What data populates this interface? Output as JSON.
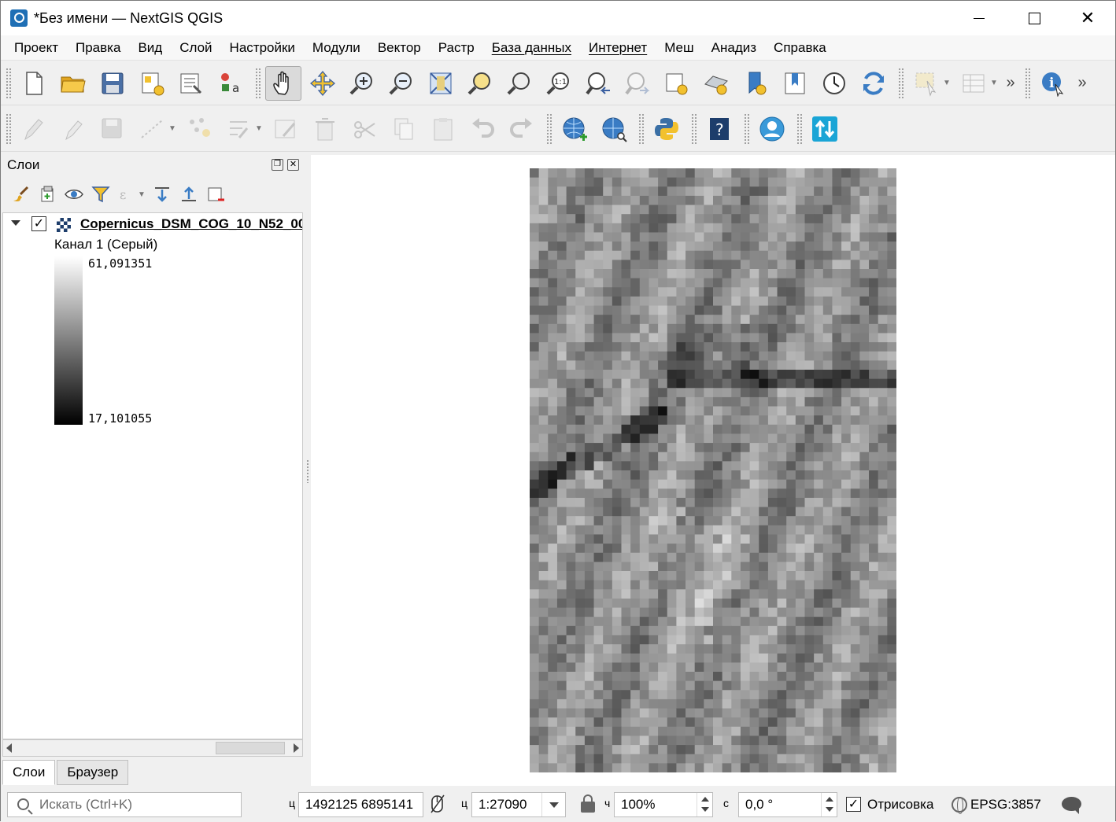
{
  "window": {
    "title": "*Без имени — NextGIS QGIS"
  },
  "menu": [
    "Проект",
    "Правка",
    "Вид",
    "Слой",
    "Настройки",
    "Модули",
    "Вектор",
    "Растр",
    "База данных",
    "Интернет",
    "Меш",
    "Анадиз",
    "Справка"
  ],
  "layers_panel": {
    "title": "Слои",
    "layer": {
      "name": "Copernicus_DSM_COG_10_N52_00",
      "checked": true,
      "band": "Канал 1 (Серый)",
      "max": "61,091351",
      "min": "17,101055"
    },
    "tabs": [
      "Слои",
      "Браузер"
    ]
  },
  "statusbar": {
    "search_placeholder": "Искать (Ctrl+K)",
    "coord_label": "ц",
    "coordinate": "1492125  6895141",
    "scale_label": "ц",
    "scale": "1:27090",
    "magnifier_label": "ч",
    "magnifier": "100%",
    "rotation_label": "с",
    "rotation": "0,0 °",
    "render": "Отрисовка",
    "crs": "EPSG:3857"
  },
  "colors": {
    "accent": "#1f6fb5",
    "layer_icon": "#1d3d6b",
    "toolbar_blue": "#3a7cc4",
    "toolbar_yellow": "#f2c12e"
  }
}
